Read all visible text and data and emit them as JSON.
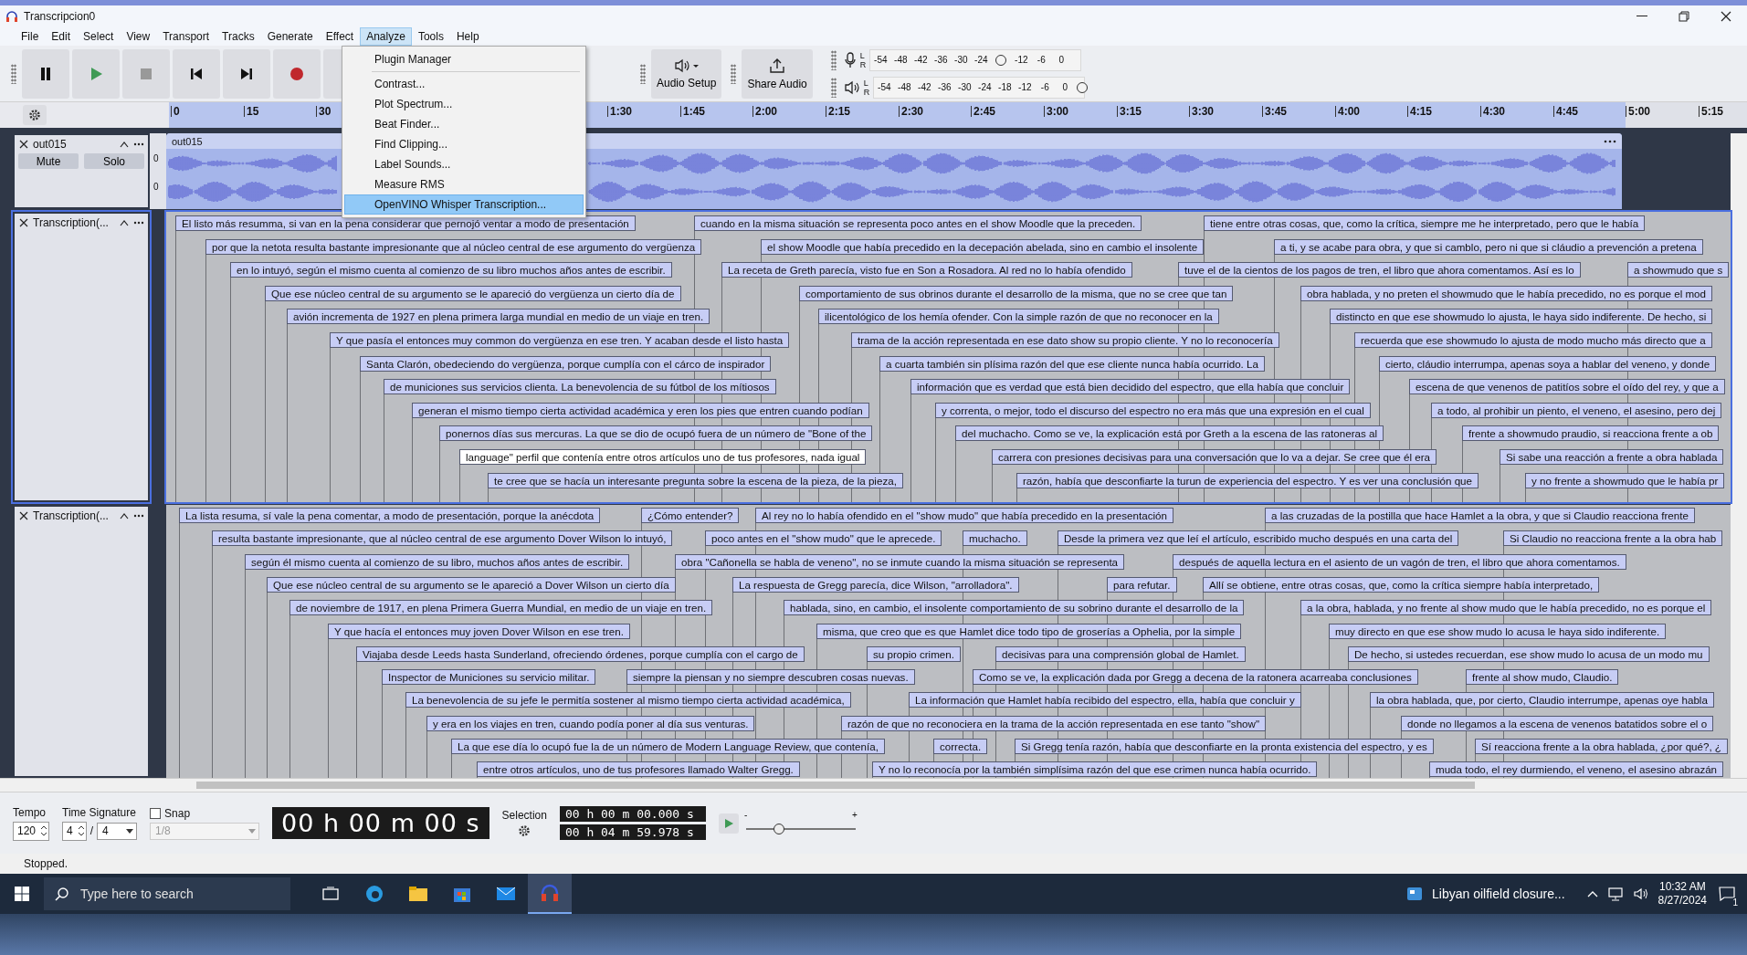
{
  "window": {
    "title": "Transcripcion0"
  },
  "menu": [
    {
      "label": "File",
      "selected": false
    },
    {
      "label": "Edit",
      "selected": false
    },
    {
      "label": "Select",
      "selected": false
    },
    {
      "label": "View",
      "selected": false
    },
    {
      "label": "Transport",
      "selected": false
    },
    {
      "label": "Tracks",
      "selected": false
    },
    {
      "label": "Generate",
      "selected": false
    },
    {
      "label": "Effect",
      "selected": false
    },
    {
      "label": "Analyze",
      "selected": true
    },
    {
      "label": "Tools",
      "selected": false
    },
    {
      "label": "Help",
      "selected": false
    }
  ],
  "analyze_menu": [
    {
      "kind": "item",
      "label": "Plugin Manager",
      "selected": false
    },
    {
      "kind": "separator"
    },
    {
      "kind": "item",
      "label": "Contrast...",
      "selected": false
    },
    {
      "kind": "item",
      "label": "Plot Spectrum...",
      "selected": false
    },
    {
      "kind": "item",
      "label": "Beat Finder...",
      "selected": false
    },
    {
      "kind": "item",
      "label": "Find Clipping...",
      "selected": false
    },
    {
      "kind": "item",
      "label": "Label Sounds...",
      "selected": false
    },
    {
      "kind": "item",
      "label": "Measure RMS",
      "selected": false
    },
    {
      "kind": "item",
      "label": "OpenVINO Whisper Transcription...",
      "selected": true
    }
  ],
  "audio_setup": "Audio Setup",
  "share_audio": "Share Audio",
  "meters": [
    {
      "kind": "record",
      "channels": [
        "L",
        "R"
      ],
      "ticks": [
        "-54",
        "-48",
        "-42",
        "-36",
        "-30",
        "-24",
        "-12",
        "-6",
        "0"
      ],
      "level": 0.62
    },
    {
      "kind": "playback",
      "channels": [
        "L",
        "R"
      ],
      "ticks": [
        "-54",
        "-48",
        "-42",
        "-36",
        "-30",
        "-24",
        "-18",
        "-12",
        "-6",
        "0"
      ],
      "level": 1
    }
  ],
  "ruler": [
    "0",
    "15",
    "30",
    "1:30",
    "1:45",
    "2:00",
    "2:15",
    "2:30",
    "2:45",
    "3:00",
    "3:15",
    "3:30",
    "3:45",
    "4:00",
    "4:15",
    "4:30",
    "4:45",
    "5:00",
    "5:15"
  ],
  "audio_track": {
    "name": "out015",
    "mute": "Mute",
    "solo": "Solo",
    "clip_name": "out015",
    "channel_scale": [
      "0",
      "0"
    ]
  },
  "label_tracks": [
    {
      "name": "Transcription(...",
      "selected": true,
      "rows": [
        [
          {
            "text": "El listo más resumma, si van en la pena considerar que pernojó ventar a modo de presentación",
            "selected": false
          },
          {
            "text": "cuando en la misma situación se representa poco antes en el show Moodle que la preceden.",
            "selected": false
          },
          {
            "text": "tiene entre otras cosas, que, como la crítica, siempre me he interpretado, pero que le había",
            "selected": false
          }
        ],
        [
          {
            "text": "por que la netota resulta bastante impresionante que al núcleo central de ese argumento do vergüenza",
            "selected": false
          },
          {
            "text": "el show Moodle que había precedido en la decepación abelada, sino en cambio el insolente",
            "selected": false
          },
          {
            "text": "a ti, y se acabe para obra, y que si camblo, pero ni que si cláudio a prevención a pretena",
            "selected": false
          }
        ],
        [
          {
            "text": "en lo intuyó, según el mismo cuenta al comienzo de su libro muchos años antes de escribir.",
            "selected": false
          },
          {
            "text": "La receta de Greth parecía, visto fue en Son a Rosadora. Al red no lo había ofendido",
            "selected": false
          },
          {
            "text": "tuve el de la cientos de los pagos de tren, el libro que ahora comentamos. Así es lo",
            "selected": false
          },
          {
            "text": "a showmudo que s",
            "selected": false
          }
        ],
        [
          {
            "text": "Que ese núcleo central de su argumento se le apareció do vergüenza un cierto día de",
            "selected": false
          },
          {
            "text": "comportamiento de sus obrinos durante el desarrollo de la misma, que no se cree que tan",
            "selected": false
          },
          {
            "text": "obra hablada, y no preten el showmudo que le había precedido, no es porque el mod",
            "selected": false
          }
        ],
        [
          {
            "text": "avión incrementa de 1927 en plena primera larga mundial en medio de un viaje en tren.",
            "selected": false
          },
          {
            "text": "ilicentológico de los hemía ofender. Con la simple razón de que no reconocer en la",
            "selected": false
          },
          {
            "text": "distincto en que ese showmudo lo ajusta, le haya sido indiferente. De hecho, si",
            "selected": false
          }
        ],
        [
          {
            "text": "Y que pasía el entonces muy common do vergüenza en ese tren. Y acaban desde el listo hasta",
            "selected": false
          },
          {
            "text": "trama de la acción representada en ese dato show su propio cliente. Y no lo reconocería",
            "selected": false
          },
          {
            "text": "recuerda que ese showmudo lo ajusta de modo mucho más directo que a",
            "selected": false
          }
        ],
        [
          {
            "text": "Santa Clarón, obedeciendo do vergüenza, porque cumplía con el cárco de inspirador",
            "selected": false
          },
          {
            "text": "a cuarta también sin plísima razón del que ese cliente nunca había ocurrido. La",
            "selected": false
          },
          {
            "text": "cierto, cláudio interrumpa, apenas soya a hablar del veneno, y donde",
            "selected": false
          }
        ],
        [
          {
            "text": "de municiones sus servicios clienta. La benevolencia de su fútbol de los mítiosos",
            "selected": false
          },
          {
            "text": "información que es verdad que está bien decidido del espectro, que ella había que concluir",
            "selected": false
          },
          {
            "text": "escena de que venenos de patitíos sobre el oído del rey, y que a",
            "selected": false
          }
        ],
        [
          {
            "text": "generan el mismo tiempo cierta actividad académica y eren los pies que entren cuando podían",
            "selected": false
          },
          {
            "text": "y correnta, o mejor, todo el discurso del espectro no era más que una expresión en el cual",
            "selected": false
          },
          {
            "text": "a todo, al prohibir un piento, el veneno, el asesino, pero dej",
            "selected": false
          }
        ],
        [
          {
            "text": "ponernos días sus mercuras. La que se dio de ocupó fuera de un número de \"Bone of the",
            "selected": false
          },
          {
            "text": "del muchacho. Como se ve, la explicación está por Greth a la escena de las ratoneras al",
            "selected": false
          },
          {
            "text": "frente a showmudo praudio, si reacciona frente a ob",
            "selected": false
          }
        ],
        [
          {
            "text": "language\" perfil que contenía entre otros artículos uno de tus profesores, nada igual",
            "selected": true
          },
          {
            "text": "carrera con presiones decisivas para una conversación que lo va a dejar. Se cree que él era",
            "selected": false
          },
          {
            "text": "Si sabe una reacción a frente a obra hablada",
            "selected": false
          }
        ],
        [
          {
            "text": "te cree que se hacía un interesante pregunta sobre la escena de la pieza, de la pieza,",
            "selected": false
          },
          {
            "text": "razón, había que desconfiarte la turun de experiencia del espectro. Y es ver una conclusión que",
            "selected": false
          },
          {
            "text": "y no frente a showmudo que le había pr",
            "selected": false
          }
        ]
      ]
    },
    {
      "name": "Transcription(...",
      "selected": false,
      "rows": [
        [
          {
            "text": "La lista resuma, sí vale la pena comentar, a modo de presentación, porque la anécdota",
            "selected": false
          },
          {
            "text": "¿Cómo entender?",
            "selected": false
          },
          {
            "text": "Al rey no lo había ofendido en el \"show mudo\" que había precedido en la presentación",
            "selected": false
          },
          {
            "text": "a las cruzadas de la postilla que hace Hamlet a la obra, y que si Claudio reacciona frente",
            "selected": false
          }
        ],
        [
          {
            "text": "resulta bastante impresionante, que al núcleo central de ese argumento Dover Wilson lo intuyó,",
            "selected": false
          },
          {
            "text": "poco antes en el \"show mudo\" que le aprecede.",
            "selected": false
          },
          {
            "text": "muchacho.",
            "selected": false
          },
          {
            "text": "Desde la primera vez que leí el artículo, escribido mucho después en una carta del",
            "selected": false
          },
          {
            "text": "Si Claudio no reacciona frente a la obra hab",
            "selected": false
          }
        ],
        [
          {
            "text": "según él mismo cuenta al comienzo de su libro, muchos años antes de escribir.",
            "selected": false
          },
          {
            "text": "obra \"Cañonella se habla de veneno\", no se inmute cuando la misma situación se representa",
            "selected": false
          },
          {
            "text": "después de aquella lectura en el asiento de un vagón de tren, el libro que ahora comentamos.",
            "selected": false
          }
        ],
        [
          {
            "text": "Que ese núcleo central de su argumento se le apareció a Dover Wilson un cierto día",
            "selected": false
          },
          {
            "text": "La respuesta de Gregg parecía, dice Wilson, \"arrolladora\".",
            "selected": false
          },
          {
            "text": "para refutar.",
            "selected": false
          },
          {
            "text": "Allí se obtiene, entre otras cosas, que, como la crítica siempre había interpretado,",
            "selected": false
          }
        ],
        [
          {
            "text": "de noviembre de 1917, en plena Primera Guerra Mundial, en medio de un viaje en tren.",
            "selected": false
          },
          {
            "text": "hablada, sino, en cambio, el insolente comportamiento de su sobrino durante el desarrollo de la",
            "selected": false
          },
          {
            "text": "a la obra, hablada, y no frente al show mudo que le había precedido, no es porque el",
            "selected": false
          }
        ],
        [
          {
            "text": "Y que hacía el entonces muy joven Dover Wilson en ese tren.",
            "selected": false
          },
          {
            "text": "misma, que creo que es que Hamlet dice todo tipo de groserías a Ophelia, por la simple",
            "selected": false
          },
          {
            "text": "muy directo en que ese show mudo lo acusa le haya sido indiferente.",
            "selected": false
          }
        ],
        [
          {
            "text": "Viajaba desde Leeds hasta Sunderland, ofreciendo órdenes, porque cumplía con el cargo de",
            "selected": false
          },
          {
            "text": "su propio crimen.",
            "selected": false
          },
          {
            "text": "decisivas para una comprensión global de Hamlet.",
            "selected": false
          },
          {
            "text": "De hecho, si ustedes recuerdan, ese show mudo lo acusa de un modo mu",
            "selected": false
          }
        ],
        [
          {
            "text": "Inspector de Municiones su servicio militar.",
            "selected": false
          },
          {
            "text": "siempre la piensan y no siempre descubren cosas nuevas.",
            "selected": false
          },
          {
            "text": "Como se ve, la explicación dada por Gregg a decena de la ratonera acarreaba conclusiones",
            "selected": false
          },
          {
            "text": "frente al show mudo, Claudio.",
            "selected": false
          }
        ],
        [
          {
            "text": "La benevolencia de su jefe le permitía sostener al mismo tiempo cierta actividad académica,",
            "selected": false
          },
          {
            "text": "La información que Hamlet había recibido del espectro, ella, había que concluir y",
            "selected": false
          },
          {
            "text": "la obra hablada, que, por cierto, Claudio interrumpe, apenas oye habla",
            "selected": false
          }
        ],
        [
          {
            "text": "y era en los viajes en tren, cuando podía poner al día sus venturas.",
            "selected": false
          },
          {
            "text": "razón de que no reconociera en la trama de la acción representada en ese tanto \"show\"",
            "selected": false
          },
          {
            "text": "donde no llegamos a la escena de venenos batatidos sobre el o",
            "selected": false
          }
        ],
        [
          {
            "text": "La que ese día lo ocupó fue la de un número de Modern Language Review, que contenía,",
            "selected": false
          },
          {
            "text": "correcta.",
            "selected": false
          },
          {
            "text": "Si Gregg tenía razón, había que desconfiarte en la pronta existencia del espectro, y es",
            "selected": false
          },
          {
            "text": "Sí reacciona frente a la obra hablada, ¿por qué?, ¿",
            "selected": false
          }
        ],
        [
          {
            "text": "entre otros artículos, uno de tus profesores llamado Walter Gregg.",
            "selected": false
          },
          {
            "text": "Y no lo reconocía por la también simplísima razón del que ese crimen nunca había ocurrido.",
            "selected": false
          },
          {
            "text": "muda todo, el rey durmiendo, el veneno, el asesino abrazán",
            "selected": false
          }
        ]
      ]
    }
  ],
  "bottom": {
    "tempo_label": "Tempo",
    "tempo": "120",
    "time_signature_label": "Time Signature",
    "beats": "4",
    "slash": "/",
    "note_value": "4",
    "snap_label": "Snap",
    "snap": false,
    "snap_value": "1/8",
    "time": "00 h 00 m 00 s",
    "selection_label": "Selection",
    "selection_start": "00 h 00 m 00.000 s",
    "selection_end": "00 h 04 m 59.978 s",
    "speed": {
      "min": "-",
      "max": "+",
      "level": 0.3
    }
  },
  "status": "Stopped.",
  "taskbar": {
    "search_placeholder": "Type here to search",
    "news": "Libyan oilfield closure...",
    "time": "10:32 AM",
    "date": "8/27/2024",
    "notifications": "1"
  }
}
